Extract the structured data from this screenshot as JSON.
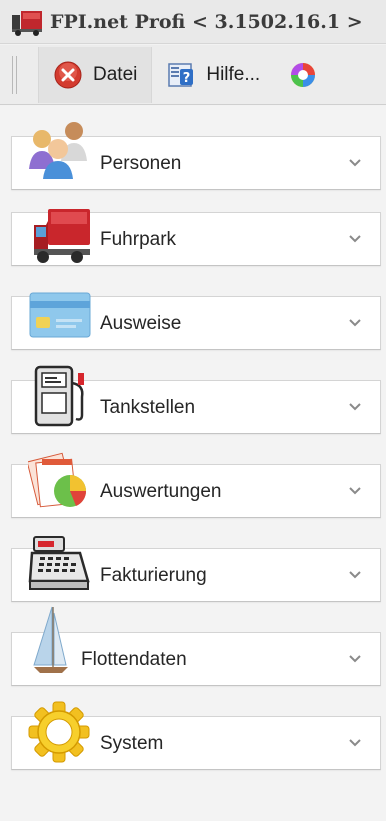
{
  "window": {
    "title": "FPI.net Profi < 3.1502.16.1 >"
  },
  "toolbar": {
    "buttons": [
      {
        "label": "Datei",
        "icon": "close-circle-icon"
      },
      {
        "label": "Hilfe...",
        "icon": "help-icon"
      },
      {
        "label": "",
        "icon": "color-wheel-icon"
      }
    ]
  },
  "nav": {
    "groups": [
      {
        "label": "Personen",
        "icon": "people-icon"
      },
      {
        "label": "Fuhrpark",
        "icon": "truck-icon"
      },
      {
        "label": "Ausweise",
        "icon": "card-icon"
      },
      {
        "label": "Tankstellen",
        "icon": "fuel-pump-icon"
      },
      {
        "label": "Auswertungen",
        "icon": "report-chart-icon"
      },
      {
        "label": "Fakturierung",
        "icon": "cash-register-icon"
      },
      {
        "label": "Flottendaten",
        "icon": "sailboat-icon"
      },
      {
        "label": "System",
        "icon": "gear-icon"
      }
    ]
  },
  "colors": {
    "background": "#f2f2f2",
    "panel": "#ffffff",
    "border": "#d4d4d4"
  }
}
